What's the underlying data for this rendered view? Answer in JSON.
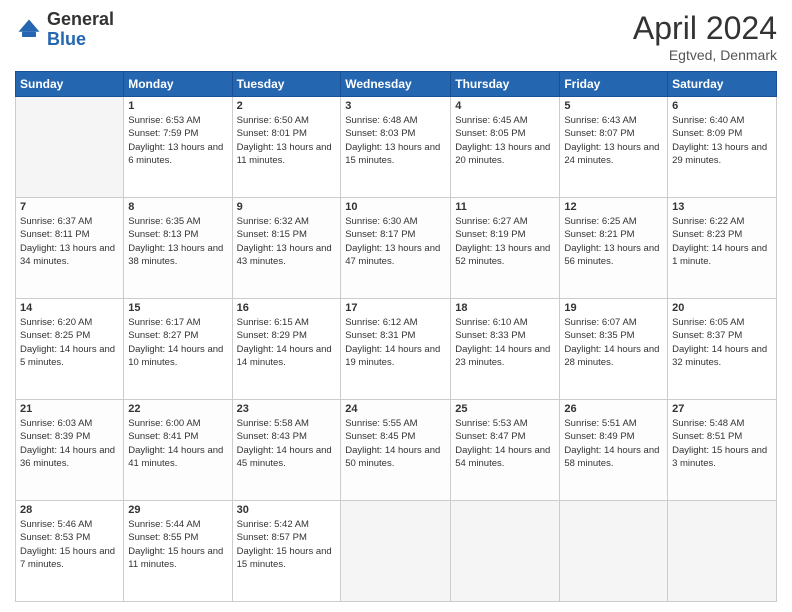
{
  "header": {
    "logo_general": "General",
    "logo_blue": "Blue",
    "month_title": "April 2024",
    "location": "Egtved, Denmark"
  },
  "weekdays": [
    "Sunday",
    "Monday",
    "Tuesday",
    "Wednesday",
    "Thursday",
    "Friday",
    "Saturday"
  ],
  "weeks": [
    [
      {
        "day": "",
        "sunrise": "",
        "sunset": "",
        "daylight": ""
      },
      {
        "day": "1",
        "sunrise": "Sunrise: 6:53 AM",
        "sunset": "Sunset: 7:59 PM",
        "daylight": "Daylight: 13 hours and 6 minutes."
      },
      {
        "day": "2",
        "sunrise": "Sunrise: 6:50 AM",
        "sunset": "Sunset: 8:01 PM",
        "daylight": "Daylight: 13 hours and 11 minutes."
      },
      {
        "day": "3",
        "sunrise": "Sunrise: 6:48 AM",
        "sunset": "Sunset: 8:03 PM",
        "daylight": "Daylight: 13 hours and 15 minutes."
      },
      {
        "day": "4",
        "sunrise": "Sunrise: 6:45 AM",
        "sunset": "Sunset: 8:05 PM",
        "daylight": "Daylight: 13 hours and 20 minutes."
      },
      {
        "day": "5",
        "sunrise": "Sunrise: 6:43 AM",
        "sunset": "Sunset: 8:07 PM",
        "daylight": "Daylight: 13 hours and 24 minutes."
      },
      {
        "day": "6",
        "sunrise": "Sunrise: 6:40 AM",
        "sunset": "Sunset: 8:09 PM",
        "daylight": "Daylight: 13 hours and 29 minutes."
      }
    ],
    [
      {
        "day": "7",
        "sunrise": "Sunrise: 6:37 AM",
        "sunset": "Sunset: 8:11 PM",
        "daylight": "Daylight: 13 hours and 34 minutes."
      },
      {
        "day": "8",
        "sunrise": "Sunrise: 6:35 AM",
        "sunset": "Sunset: 8:13 PM",
        "daylight": "Daylight: 13 hours and 38 minutes."
      },
      {
        "day": "9",
        "sunrise": "Sunrise: 6:32 AM",
        "sunset": "Sunset: 8:15 PM",
        "daylight": "Daylight: 13 hours and 43 minutes."
      },
      {
        "day": "10",
        "sunrise": "Sunrise: 6:30 AM",
        "sunset": "Sunset: 8:17 PM",
        "daylight": "Daylight: 13 hours and 47 minutes."
      },
      {
        "day": "11",
        "sunrise": "Sunrise: 6:27 AM",
        "sunset": "Sunset: 8:19 PM",
        "daylight": "Daylight: 13 hours and 52 minutes."
      },
      {
        "day": "12",
        "sunrise": "Sunrise: 6:25 AM",
        "sunset": "Sunset: 8:21 PM",
        "daylight": "Daylight: 13 hours and 56 minutes."
      },
      {
        "day": "13",
        "sunrise": "Sunrise: 6:22 AM",
        "sunset": "Sunset: 8:23 PM",
        "daylight": "Daylight: 14 hours and 1 minute."
      }
    ],
    [
      {
        "day": "14",
        "sunrise": "Sunrise: 6:20 AM",
        "sunset": "Sunset: 8:25 PM",
        "daylight": "Daylight: 14 hours and 5 minutes."
      },
      {
        "day": "15",
        "sunrise": "Sunrise: 6:17 AM",
        "sunset": "Sunset: 8:27 PM",
        "daylight": "Daylight: 14 hours and 10 minutes."
      },
      {
        "day": "16",
        "sunrise": "Sunrise: 6:15 AM",
        "sunset": "Sunset: 8:29 PM",
        "daylight": "Daylight: 14 hours and 14 minutes."
      },
      {
        "day": "17",
        "sunrise": "Sunrise: 6:12 AM",
        "sunset": "Sunset: 8:31 PM",
        "daylight": "Daylight: 14 hours and 19 minutes."
      },
      {
        "day": "18",
        "sunrise": "Sunrise: 6:10 AM",
        "sunset": "Sunset: 8:33 PM",
        "daylight": "Daylight: 14 hours and 23 minutes."
      },
      {
        "day": "19",
        "sunrise": "Sunrise: 6:07 AM",
        "sunset": "Sunset: 8:35 PM",
        "daylight": "Daylight: 14 hours and 28 minutes."
      },
      {
        "day": "20",
        "sunrise": "Sunrise: 6:05 AM",
        "sunset": "Sunset: 8:37 PM",
        "daylight": "Daylight: 14 hours and 32 minutes."
      }
    ],
    [
      {
        "day": "21",
        "sunrise": "Sunrise: 6:03 AM",
        "sunset": "Sunset: 8:39 PM",
        "daylight": "Daylight: 14 hours and 36 minutes."
      },
      {
        "day": "22",
        "sunrise": "Sunrise: 6:00 AM",
        "sunset": "Sunset: 8:41 PM",
        "daylight": "Daylight: 14 hours and 41 minutes."
      },
      {
        "day": "23",
        "sunrise": "Sunrise: 5:58 AM",
        "sunset": "Sunset: 8:43 PM",
        "daylight": "Daylight: 14 hours and 45 minutes."
      },
      {
        "day": "24",
        "sunrise": "Sunrise: 5:55 AM",
        "sunset": "Sunset: 8:45 PM",
        "daylight": "Daylight: 14 hours and 50 minutes."
      },
      {
        "day": "25",
        "sunrise": "Sunrise: 5:53 AM",
        "sunset": "Sunset: 8:47 PM",
        "daylight": "Daylight: 14 hours and 54 minutes."
      },
      {
        "day": "26",
        "sunrise": "Sunrise: 5:51 AM",
        "sunset": "Sunset: 8:49 PM",
        "daylight": "Daylight: 14 hours and 58 minutes."
      },
      {
        "day": "27",
        "sunrise": "Sunrise: 5:48 AM",
        "sunset": "Sunset: 8:51 PM",
        "daylight": "Daylight: 15 hours and 3 minutes."
      }
    ],
    [
      {
        "day": "28",
        "sunrise": "Sunrise: 5:46 AM",
        "sunset": "Sunset: 8:53 PM",
        "daylight": "Daylight: 15 hours and 7 minutes."
      },
      {
        "day": "29",
        "sunrise": "Sunrise: 5:44 AM",
        "sunset": "Sunset: 8:55 PM",
        "daylight": "Daylight: 15 hours and 11 minutes."
      },
      {
        "day": "30",
        "sunrise": "Sunrise: 5:42 AM",
        "sunset": "Sunset: 8:57 PM",
        "daylight": "Daylight: 15 hours and 15 minutes."
      },
      {
        "day": "",
        "sunrise": "",
        "sunset": "",
        "daylight": ""
      },
      {
        "day": "",
        "sunrise": "",
        "sunset": "",
        "daylight": ""
      },
      {
        "day": "",
        "sunrise": "",
        "sunset": "",
        "daylight": ""
      },
      {
        "day": "",
        "sunrise": "",
        "sunset": "",
        "daylight": ""
      }
    ]
  ]
}
